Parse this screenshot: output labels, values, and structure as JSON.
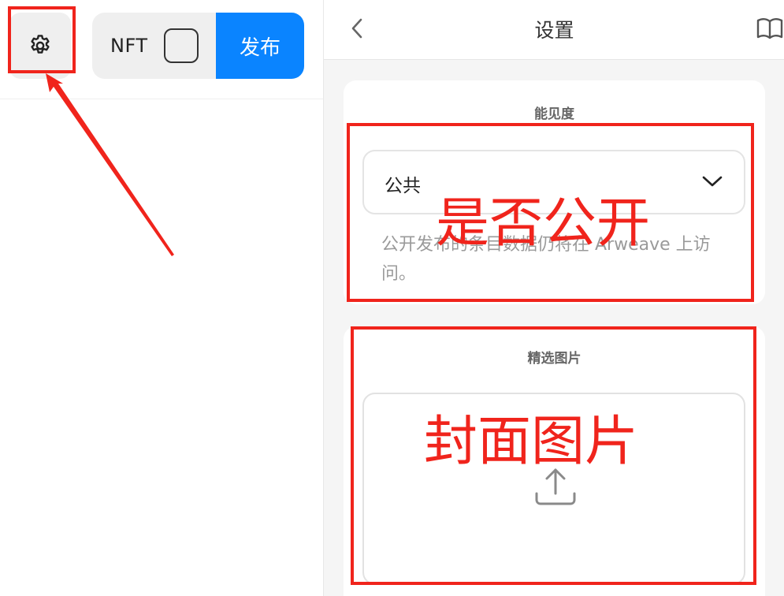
{
  "toolbar": {
    "settings_icon": "gear-icon",
    "nft_label": "NFT",
    "nft_checked": false,
    "publish_label": "发布"
  },
  "settings_panel": {
    "title": "设置",
    "back_icon": "chevron-left-icon",
    "guide_icon": "book-icon",
    "visibility": {
      "title": "能见度",
      "selected": "公共",
      "help_text": "公开发布的条目数据仍将在 Arweave 上访问。"
    },
    "featured_image": {
      "title": "精选图片",
      "upload_icon": "upload-icon"
    }
  },
  "annotations": {
    "visibility_note": "是否公开",
    "cover_note": "封面图片",
    "color": "#f0241c"
  },
  "colors": {
    "accent": "#0a84ff",
    "annotation": "#f0241c"
  }
}
